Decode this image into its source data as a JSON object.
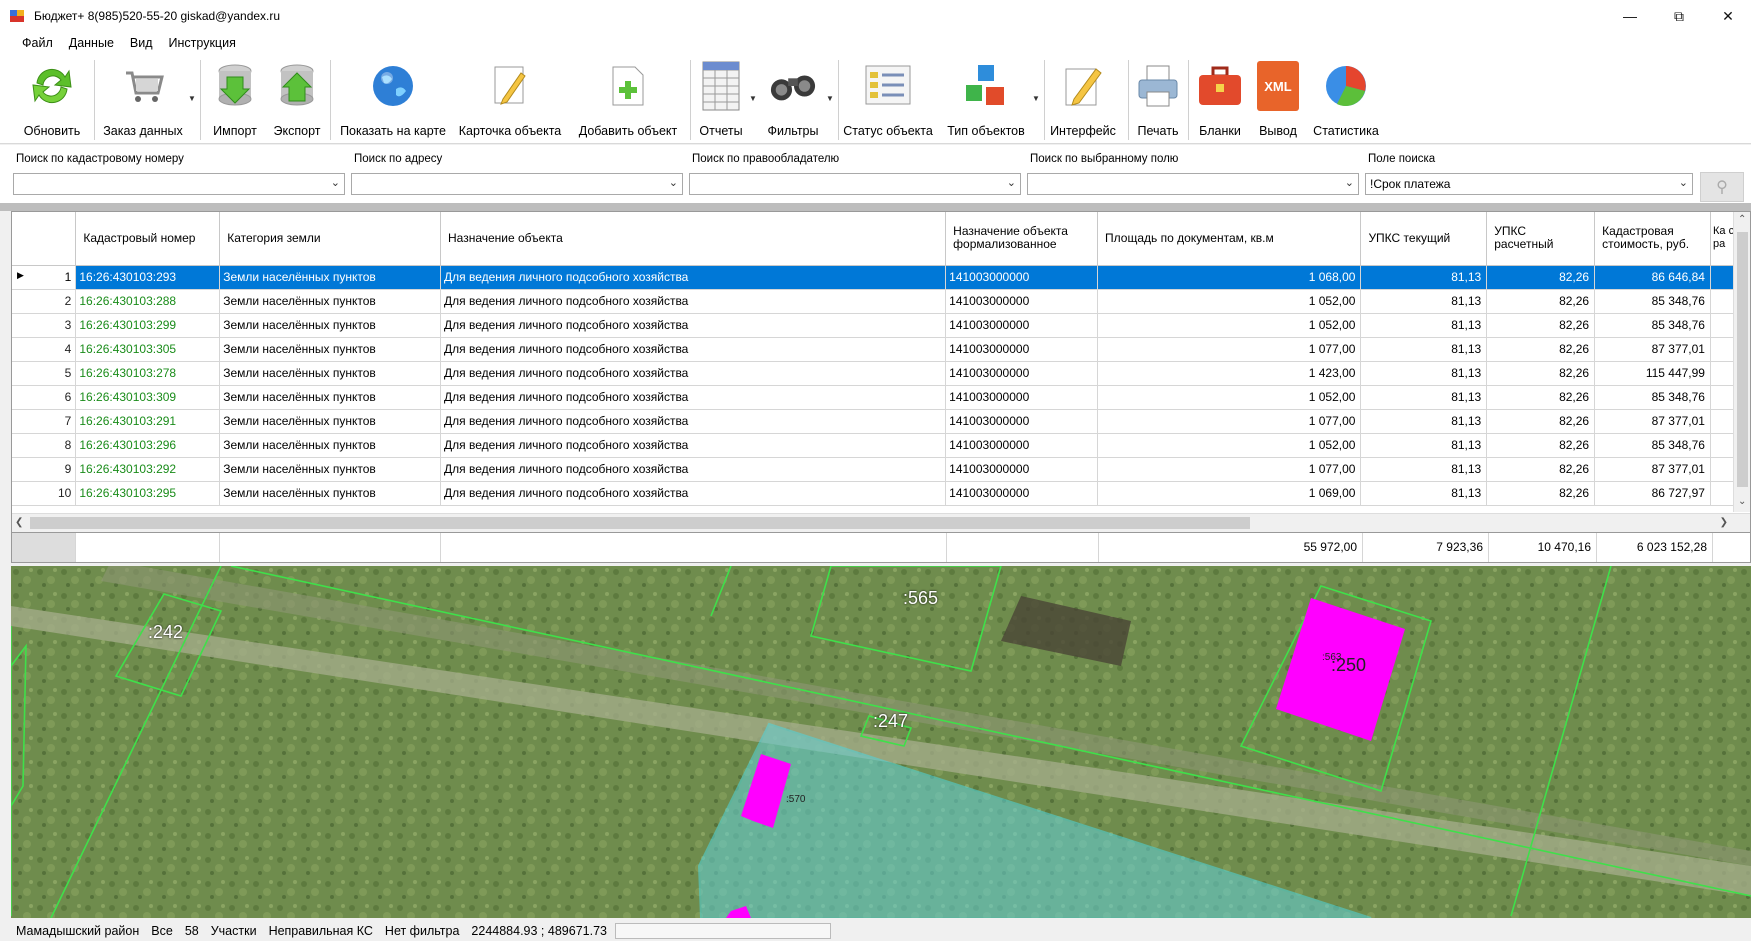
{
  "title": "Бюджет+ 8(985)520-55-20 giskad@yandex.ru",
  "menu": [
    "Файл",
    "Данные",
    "Вид",
    "Инструкция"
  ],
  "toolbar": [
    {
      "label": "Обновить",
      "icon": "refresh-icon"
    },
    {
      "label": "Заказ данных",
      "icon": "cart-icon"
    },
    {
      "label": "Импорт",
      "icon": "db-import-icon"
    },
    {
      "label": "Экспорт",
      "icon": "db-export-icon"
    },
    {
      "label": "Показать на карте",
      "icon": "globe-icon"
    },
    {
      "label": "Карточка объекта",
      "icon": "edit-card-icon"
    },
    {
      "label": "Добавить объект",
      "icon": "add-document-icon"
    },
    {
      "label": "Отчеты",
      "icon": "report-icon"
    },
    {
      "label": "Фильтры",
      "icon": "binoculars-icon"
    },
    {
      "label": "Статус объекта",
      "icon": "checklist-icon"
    },
    {
      "label": "Тип объектов",
      "icon": "cubes-icon"
    },
    {
      "label": "Интерфейс",
      "icon": "pencil-icon"
    },
    {
      "label": "Печать",
      "icon": "printer-icon"
    },
    {
      "label": "Бланки",
      "icon": "briefcase-icon"
    },
    {
      "label": "Вывод",
      "icon": "xml-icon"
    },
    {
      "label": "Статистика",
      "icon": "pie-chart-icon"
    }
  ],
  "xml_badge": "XML",
  "search": {
    "cadastral": {
      "label": "Поиск по кадастровому номеру",
      "value": ""
    },
    "address": {
      "label": "Поиск по адресу",
      "value": ""
    },
    "owner": {
      "label": "Поиск по правообладателю",
      "value": ""
    },
    "field": {
      "label": "Поиск по выбранному полю",
      "value": ""
    },
    "search_field": {
      "label": "Поле поиска",
      "value": "!Срок платежа"
    }
  },
  "grid": {
    "columns": [
      "Кадастровый номер",
      "Категория земли",
      "Назначение объекта",
      "Назначение объекта формализованное",
      "Площадь по документам, кв.м",
      "УПКС текущий",
      "УПКС расчетный",
      "Кадастровая стоимость, руб.",
      "Ка ст ра"
    ],
    "rows": [
      {
        "n": "1",
        "kad": "16:26:430103:293",
        "cat": "Земли населённых пунктов",
        "purpose": "Для ведения личного подсобного хозяйства",
        "formal": "141003000000",
        "area": "1 068,00",
        "upks": "81,13",
        "upks_calc": "82,26",
        "cost": "86 646,84"
      },
      {
        "n": "2",
        "kad": "16:26:430103:288",
        "cat": "Земли населённых пунктов",
        "purpose": "Для ведения личного подсобного хозяйства",
        "formal": "141003000000",
        "area": "1 052,00",
        "upks": "81,13",
        "upks_calc": "82,26",
        "cost": "85 348,76"
      },
      {
        "n": "3",
        "kad": "16:26:430103:299",
        "cat": "Земли населённых пунктов",
        "purpose": "Для ведения личного подсобного хозяйства",
        "formal": "141003000000",
        "area": "1 052,00",
        "upks": "81,13",
        "upks_calc": "82,26",
        "cost": "85 348,76"
      },
      {
        "n": "4",
        "kad": "16:26:430103:305",
        "cat": "Земли населённых пунктов",
        "purpose": "Для ведения личного подсобного хозяйства",
        "formal": "141003000000",
        "area": "1 077,00",
        "upks": "81,13",
        "upks_calc": "82,26",
        "cost": "87 377,01"
      },
      {
        "n": "5",
        "kad": "16:26:430103:278",
        "cat": "Земли населённых пунктов",
        "purpose": "Для ведения личного подсобного хозяйства",
        "formal": "141003000000",
        "area": "1 423,00",
        "upks": "81,13",
        "upks_calc": "82,26",
        "cost": "115 447,99"
      },
      {
        "n": "6",
        "kad": "16:26:430103:309",
        "cat": "Земли населённых пунктов",
        "purpose": "Для ведения личного подсобного хозяйства",
        "formal": "141003000000",
        "area": "1 052,00",
        "upks": "81,13",
        "upks_calc": "82,26",
        "cost": "85 348,76"
      },
      {
        "n": "7",
        "kad": "16:26:430103:291",
        "cat": "Земли населённых пунктов",
        "purpose": "Для ведения личного подсобного хозяйства",
        "formal": "141003000000",
        "area": "1 077,00",
        "upks": "81,13",
        "upks_calc": "82,26",
        "cost": "87 377,01"
      },
      {
        "n": "8",
        "kad": "16:26:430103:296",
        "cat": "Земли населённых пунктов",
        "purpose": "Для ведения личного подсобного хозяйства",
        "formal": "141003000000",
        "area": "1 052,00",
        "upks": "81,13",
        "upks_calc": "82,26",
        "cost": "85 348,76"
      },
      {
        "n": "9",
        "kad": "16:26:430103:292",
        "cat": "Земли населённых пунктов",
        "purpose": "Для ведения личного подсобного хозяйства",
        "formal": "141003000000",
        "area": "1 077,00",
        "upks": "81,13",
        "upks_calc": "82,26",
        "cost": "87 377,01"
      },
      {
        "n": "10",
        "kad": "16:26:430103:295",
        "cat": "Земли населённых пунктов",
        "purpose": "Для ведения личного подсобного хозяйства",
        "formal": "141003000000",
        "area": "1 069,00",
        "upks": "81,13",
        "upks_calc": "82,26",
        "cost": "86 727,97"
      }
    ],
    "selected_row": 1
  },
  "totals": {
    "area": "55 972,00",
    "upks": "7 923,36",
    "upks_calc": "10 470,16",
    "cost": "6 023 152,28"
  },
  "map": {
    "labels": [
      ":242",
      ":565",
      ":247",
      ":250",
      ":563",
      ":570"
    ],
    "colors": {
      "parcel_outline": "#3fe04a",
      "selected_parcel": "#4fd6e0",
      "building": "#ff00ff"
    }
  },
  "status": {
    "district": "Мамадышский район",
    "scope": "Все",
    "count": "58",
    "layer": "Участки",
    "ks": "Неправильная КС",
    "filter": "Нет фильтра",
    "coords": "2244884.93 ; 489671.73"
  }
}
